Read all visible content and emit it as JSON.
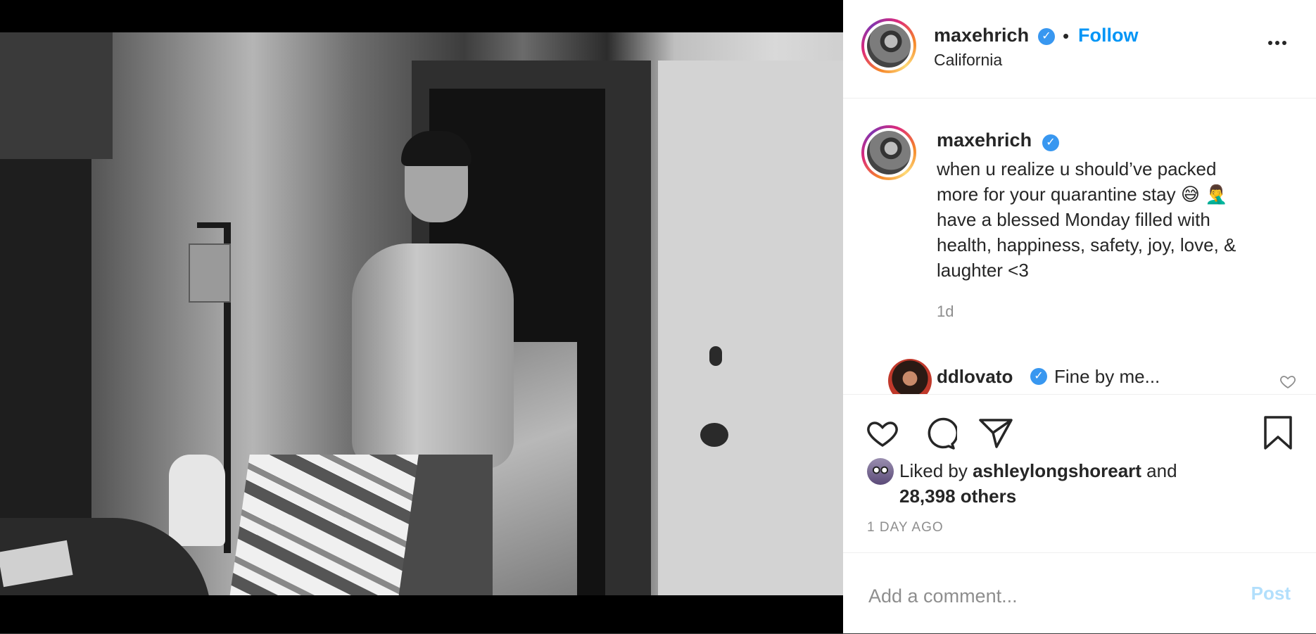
{
  "post": {
    "username": "maxehrich",
    "separator": "•",
    "follow_label": "Follow",
    "location": "California",
    "caption": "when u realize u should’ve packed\nmore for your quarantine stay 😅 🤦‍♂️\nhave a blessed Monday filled with\nhealth, happiness, safety, joy, love, &\nlaughter <3",
    "caption_age": "1d"
  },
  "comment": {
    "username": "ddlovato",
    "text": "Fine by me..."
  },
  "likes": {
    "prefix": "Liked by",
    "user": "ashleylongshoreart",
    "conjunction": "and",
    "others": "28,398 others"
  },
  "timestamp": "1 DAY AGO",
  "composer": {
    "placeholder": "Add a comment...",
    "post_label": "Post"
  },
  "icons": {
    "verified": "verified-badge-icon",
    "more": "more-options-icon",
    "like": "heart-icon",
    "comment": "comment-bubble-icon",
    "share": "paper-plane-icon",
    "save": "bookmark-icon"
  },
  "colors": {
    "link_blue": "#0095f6",
    "verified_blue": "#3897f0",
    "muted_gray": "#8e8e8e",
    "post_disabled": "#b2dffc"
  }
}
